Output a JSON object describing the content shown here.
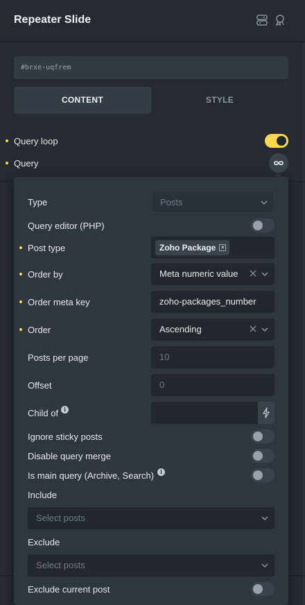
{
  "header": {
    "title": "Repeater Slide"
  },
  "element_id": "#brxe-uqfrem",
  "tabs": {
    "content": "CONTENT",
    "style": "STYLE"
  },
  "query_loop": {
    "label": "Query loop",
    "enabled": true
  },
  "query": {
    "label": "Query"
  },
  "popup": {
    "type": {
      "label": "Type",
      "value": "Posts"
    },
    "query_editor": {
      "label": "Query editor (PHP)",
      "enabled": false
    },
    "post_type": {
      "label": "Post type",
      "tag": "Zoho Package"
    },
    "order_by": {
      "label": "Order by",
      "value": "Meta numeric value"
    },
    "order_meta_key": {
      "label": "Order meta key",
      "value": "zoho-packages_number"
    },
    "order": {
      "label": "Order",
      "value": "Ascending"
    },
    "posts_per_page": {
      "label": "Posts per page",
      "placeholder": "10"
    },
    "offset": {
      "label": "Offset",
      "placeholder": "0"
    },
    "child_of": {
      "label": "Child of"
    },
    "ignore_sticky": {
      "label": "Ignore sticky posts",
      "enabled": false
    },
    "disable_merge": {
      "label": "Disable query merge",
      "enabled": false
    },
    "is_main_query": {
      "label": "Is main query (Archive, Search)",
      "enabled": false
    },
    "include": {
      "label": "Include",
      "placeholder": "Select posts"
    },
    "exclude": {
      "label": "Exclude",
      "placeholder": "Select posts"
    },
    "exclude_current": {
      "label": "Exclude current post",
      "enabled": false
    }
  },
  "colors": {
    "accent": "#ffd64f",
    "panel": "#262b31",
    "popup": "#2f363e",
    "field": "#23282e"
  }
}
